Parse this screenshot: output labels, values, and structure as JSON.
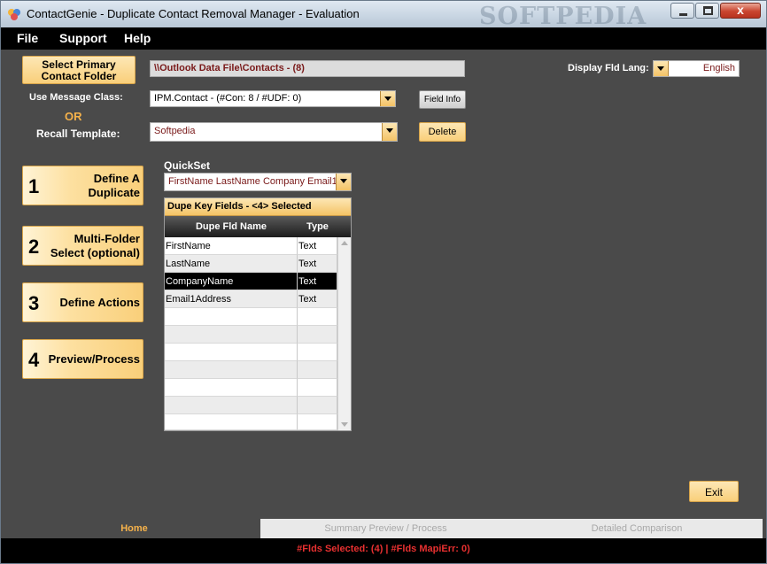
{
  "window": {
    "title": "ContactGenie - Duplicate Contact Removal Manager - Evaluation",
    "watermark": "SOFTPEDIA",
    "close_label": "x"
  },
  "menu": {
    "items": [
      "File",
      "Support",
      "Help"
    ]
  },
  "top": {
    "select_primary_label_1": "Select Primary",
    "select_primary_label_2": "Contact Folder",
    "folder_path": "\\\\Outlook Data File\\Contacts - (8)",
    "display_lang_label": "Display Fld Lang:",
    "display_lang_value": "English",
    "message_class_label": "Use Message Class:",
    "message_class_value": "IPM.Contact - (#Con: 8 / #UDF: 0)",
    "field_info_label": "Field Info",
    "or_label": "OR",
    "recall_template_label": "Recall Template:",
    "recall_template_value": "Softpedia",
    "delete_label": "Delete"
  },
  "steps": [
    {
      "num": "1",
      "label_1": "Define A",
      "label_2": "Duplicate"
    },
    {
      "num": "2",
      "label_1": "Multi-Folder",
      "label_2": "Select (optional)"
    },
    {
      "num": "3",
      "label_1": "Define Actions",
      "label_2": ""
    },
    {
      "num": "4",
      "label_1": "Preview/Process",
      "label_2": ""
    }
  ],
  "quickset": {
    "label": "QuickSet",
    "value": "FirstName LastName Company Email1"
  },
  "dupe_grid": {
    "title": "Dupe Key Fields - <4> Selected",
    "columns": [
      "Dupe Fld Name",
      "Type"
    ],
    "rows": [
      {
        "name": "FirstName",
        "type": "Text"
      },
      {
        "name": "LastName",
        "type": "Text"
      },
      {
        "name": "CompanyName",
        "type": "Text"
      },
      {
        "name": "Email1Address",
        "type": "Text"
      }
    ]
  },
  "exit_label": "Exit",
  "tabs": [
    "Home",
    "Summary Preview / Process",
    "Detailed Comparison"
  ],
  "status": "#Flds Selected: (4) | #Flds MapiErr: 0)",
  "colors": {
    "accent_orange": "#f9cf7a",
    "status_red": "#e83030",
    "home_tab": "#f6b24a",
    "path_text": "#7a1a1a"
  }
}
